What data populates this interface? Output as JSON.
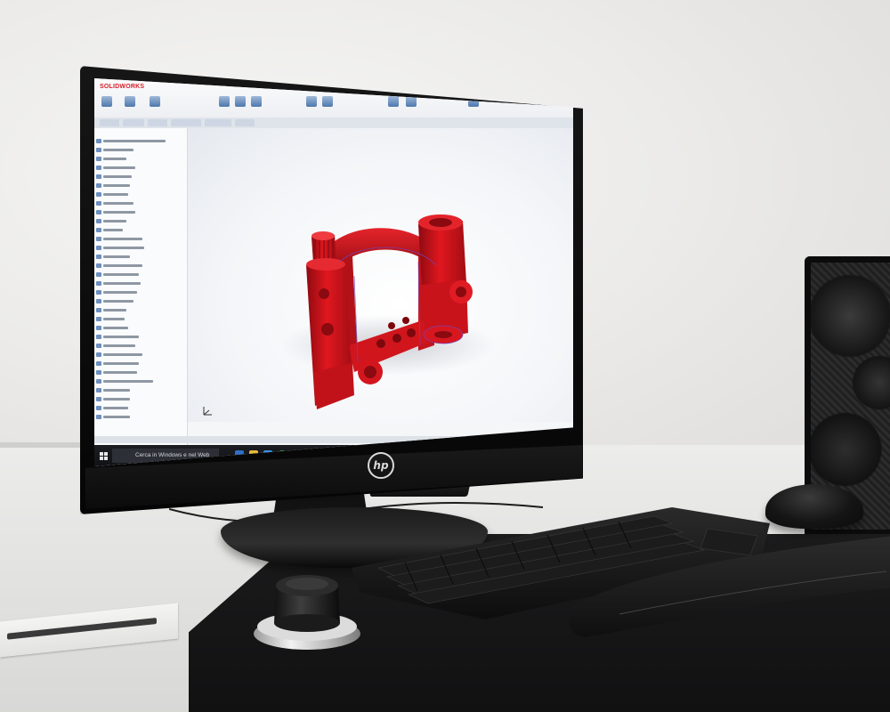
{
  "scene": {
    "type": "Office desk with monitor showing 3D CAD software",
    "colors": {
      "wall": "#ecebea",
      "desk": "#e6e6e5",
      "part_red": "#d6141c",
      "monitor_black": "#0b0b0b",
      "screen_bg": "#f5f6f8",
      "taskbar": "#111216"
    }
  },
  "monitor": {
    "brand_logo": "hp",
    "app": {
      "name": "SOLIDWORKS",
      "taskbar_search_placeholder": "Cerca in Windows e nel Web"
    }
  },
  "icons": {
    "windows": "windows-start-icon",
    "triad": "axis-triad-icon",
    "hp": "hp-logo-icon"
  }
}
